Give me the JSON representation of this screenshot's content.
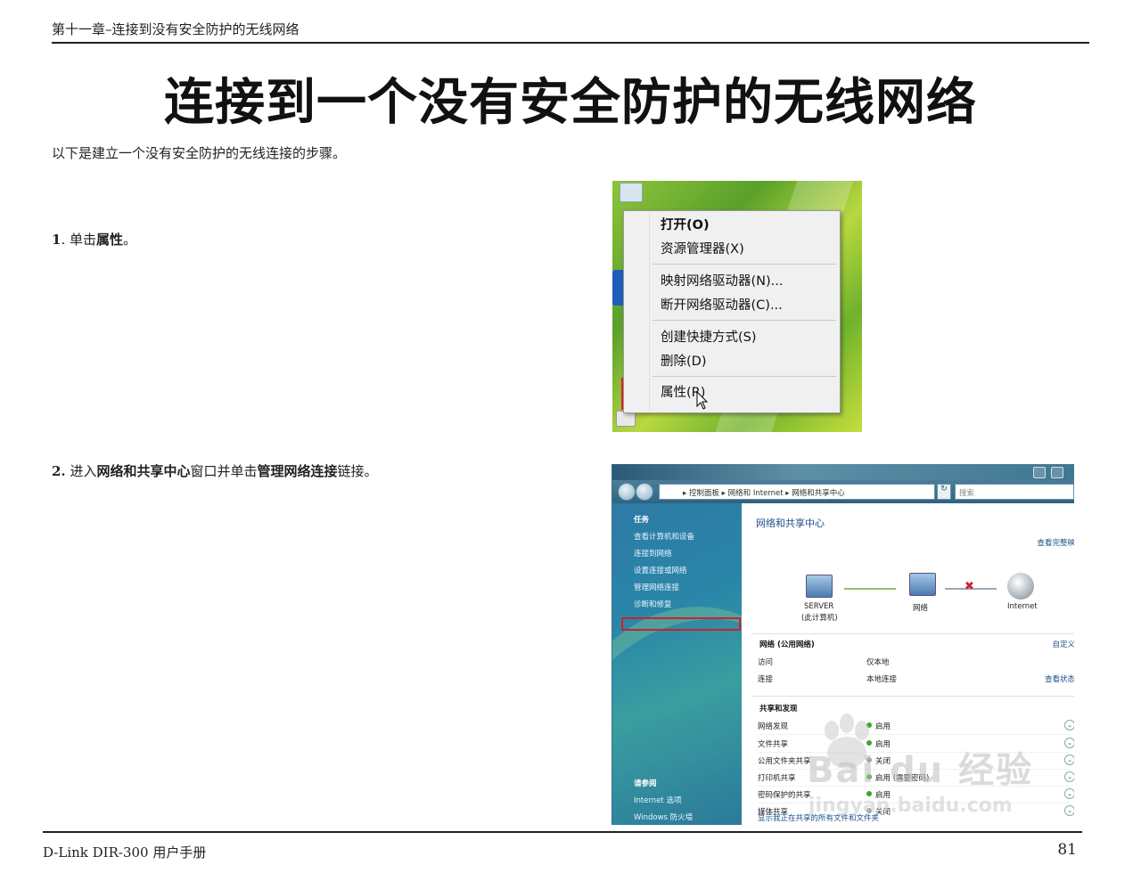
{
  "header": {
    "running_head": "第十一章–连接到没有安全防护的无线网络"
  },
  "title": "连接到一个没有安全防护的无线网络",
  "intro": "以下是建立一个没有安全防护的无线连接的步骤。",
  "steps": [
    {
      "num": "1",
      "pre": ". 单击",
      "bold": "属性",
      "post": "。"
    },
    {
      "num": "2.",
      "pre": " 进入",
      "bold": "网络和共享中心",
      "mid": "窗口并单击",
      "bold2": "管理网络连接",
      "post": "链接。"
    }
  ],
  "context_menu": {
    "items": [
      "打开(O)",
      "资源管理器(X)",
      "映射网络驱动器(N)...",
      "断开网络驱动器(C)...",
      "创建快捷方式(S)",
      "删除(D)",
      "属性(R)"
    ],
    "highlight_color": "#e0202a"
  },
  "network_window": {
    "address": "▸ 控制面板 ▸ 网络和 Internet ▸ 网络和共享中心",
    "search_placeholder": "搜索",
    "tasks_head": "任务",
    "tasks": [
      "查看计算机和设备",
      "连接到网络",
      "设置连接或网络",
      "管理网络连接",
      "诊断和修复"
    ],
    "see_also_head": "请参阅",
    "see_also": [
      "Internet 选项",
      "Windows 防火墙"
    ],
    "content_title": "网络和共享中心",
    "full_map": "查看完整映",
    "nodes": {
      "server": "SERVER",
      "server_sub": "(此计算机)",
      "network": "网络",
      "internet": "Internet"
    },
    "network_section": "网络 (公用网络)",
    "customize": "自定义",
    "access_label": "访问",
    "access_value": "仅本地",
    "connection_label": "连接",
    "connection_value": "本地连接",
    "view_status": "查看状态",
    "sharing_head": "共享和发现",
    "sharing_rows": [
      {
        "label": "网络发现",
        "value": "启用",
        "state": "on"
      },
      {
        "label": "文件共享",
        "value": "启用",
        "state": "on"
      },
      {
        "label": "公用文件夹共享",
        "value": "关闭",
        "state": "off"
      },
      {
        "label": "打印机共享",
        "value": "启用 (需要密码)",
        "state": "on"
      },
      {
        "label": "密码保护的共享",
        "value": "启用",
        "state": "on"
      },
      {
        "label": "媒体共享",
        "value": "关闭",
        "state": "off"
      }
    ],
    "bottom_link": "显示我正在共享的所有文件和文件夹",
    "accent_color": "#1c4f86"
  },
  "watermark": {
    "brand": "Bai du 经验",
    "url": "jingyan.baidu.com"
  },
  "footer": {
    "left": "D-Link DIR-300 用户手册",
    "page": "81"
  }
}
